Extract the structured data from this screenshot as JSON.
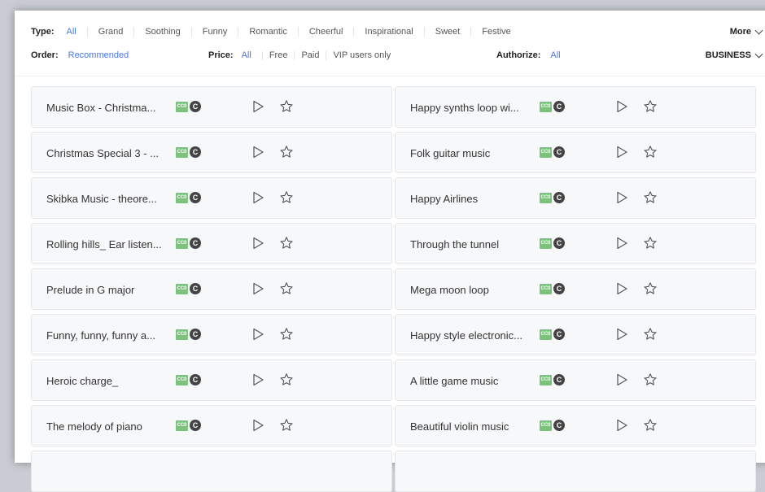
{
  "filters": {
    "type_label": "Type:",
    "type_options": [
      "All",
      "Grand",
      "Soothing",
      "Funny",
      "Romantic",
      "Cheerful",
      "Inspirational",
      "Sweet",
      "Festive"
    ],
    "type_active": "All",
    "more_label": "More",
    "order_label": "Order:",
    "order_value": "Recommended",
    "price_label": "Price:",
    "price_options": [
      "All",
      "Free",
      "Paid",
      "VIP users only"
    ],
    "price_active": "All",
    "authorize_label": "Authorize:",
    "authorize_value": "All",
    "business_label": "BUSINESS"
  },
  "license_badges": {
    "cc0": "CC0",
    "c": "C"
  },
  "tracks_left": [
    "Music Box - Christma...",
    "Christmas Special 3 - ...",
    "Skibka Music - theore...",
    "Rolling hills_ Ear listen...",
    "Prelude in G major",
    "Funny, funny, funny a...",
    "Heroic charge_",
    "The melody of piano"
  ],
  "tracks_right": [
    "Happy synths loop wi...",
    "Folk guitar music",
    "Happy Airlines",
    "Through the tunnel",
    "Mega moon loop",
    "Happy style electronic...",
    "A little game music",
    "Beautiful violin music"
  ],
  "colors": {
    "accent": "#4a77e0",
    "cc0_green": "#7cc27c",
    "card_bg": "#f7f8fa"
  }
}
